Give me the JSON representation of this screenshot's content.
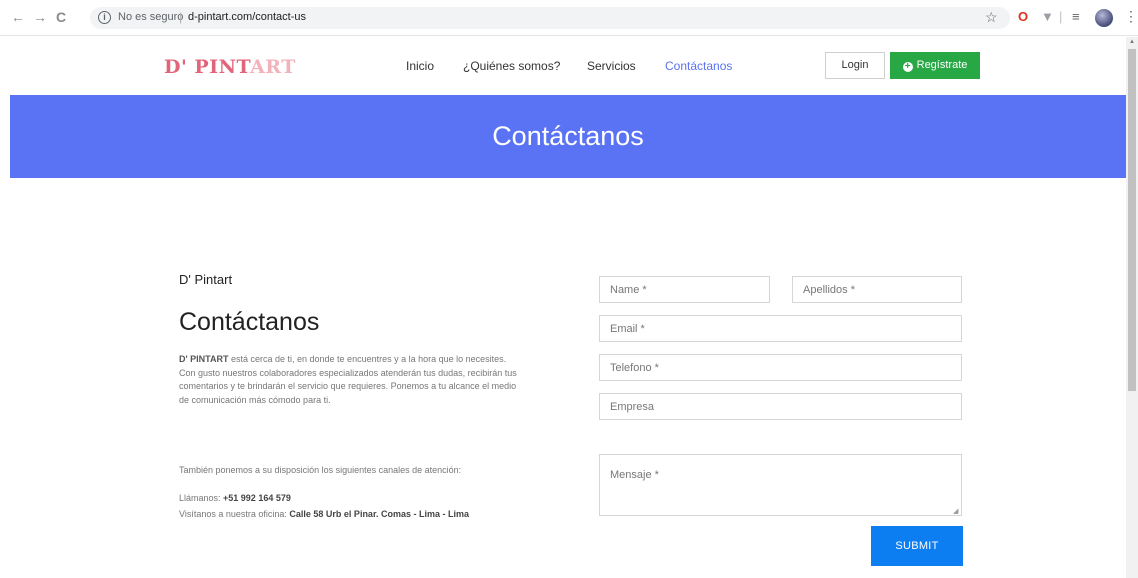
{
  "browser": {
    "back": "←",
    "forward": "→",
    "reload": "C",
    "info_icon": "i",
    "security_label": "No es seguro",
    "separator": "|",
    "url": "d-pintart.com/contact-us",
    "star": "☆",
    "ext_opera": "O",
    "ext_v": "▼",
    "ext_sep": "|",
    "ext_list": "≡",
    "menu": "⋮"
  },
  "header": {
    "logo_part1": "D' PINT",
    "logo_part2": "ART",
    "nav": [
      {
        "label": "Inicio"
      },
      {
        "label": "¿Quiénes somos?"
      },
      {
        "label": "Servicios"
      },
      {
        "label": "Contáctanos"
      }
    ],
    "login_label": "Login",
    "register_label": "Regístrate",
    "register_icon": "+"
  },
  "banner": {
    "title": "Contáctanos"
  },
  "info": {
    "brand": "D' Pintart",
    "heading": "Contáctanos",
    "desc_brand": "D' PINTART",
    "desc_text": " está cerca de ti, en donde te encuentres y a la hora que lo necesites. Con gusto nuestros colaboradores especializados atenderán tus dudas, recibirán tus comentarios y te brindarán el servicio que requieres. Ponemos a tu alcance el medio de comunicación más cómodo para ti.",
    "channels": "También ponemos a su disposición los siguientes canales de atención:",
    "phone_label": "Llámanos: ",
    "phone_value": "+51 992 164 579",
    "office_label": "Visítanos a nuestra oficina: ",
    "office_value": "Calle 58 Urb el Pinar. Comas - Lima - Lima"
  },
  "form": {
    "name_placeholder": "Name *",
    "apellidos_placeholder": "Apellidos *",
    "email_placeholder": "Email *",
    "telefono_placeholder": "Telefono *",
    "empresa_placeholder": "Empresa",
    "mensaje_placeholder": "Mensaje *",
    "submit_label": "SUBMIT"
  },
  "colors": {
    "banner": "#5a73f5",
    "nav_active": "#5b73f0",
    "register": "#28a745",
    "submit": "#0d7df2",
    "logo_dark": "#e1657a",
    "logo_light": "#f3b1bb"
  }
}
